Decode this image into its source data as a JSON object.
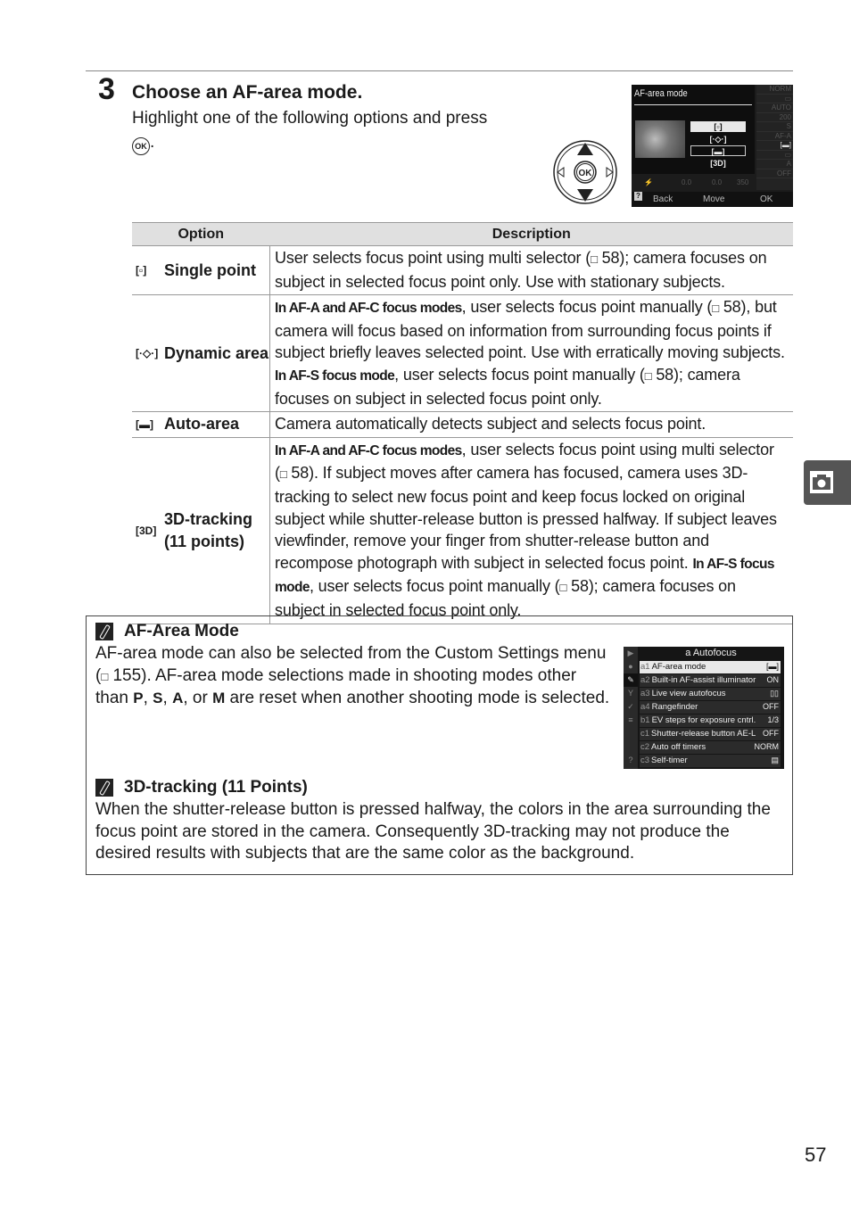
{
  "step": {
    "number": "3",
    "title": "Choose an AF-area mode.",
    "body": "Highlight one of the following options and press",
    "ok_glyph": "OK",
    "body_end": "."
  },
  "camera_screen": {
    "title": "AF-area mode",
    "options": [
      "[▫]",
      "[·◇·]",
      "[▬]",
      "[3D]"
    ],
    "selected_index": 0,
    "side_panel": [
      "NORM",
      "▭",
      "AUTO",
      "200",
      "S",
      "AF-A",
      "[▬]",
      "▭",
      "A",
      "OFF"
    ],
    "bottom_strip": [
      "⚡",
      "0.0",
      "0.0",
      "350"
    ],
    "footer": {
      "help": "?",
      "back": "Back",
      "move": "Move",
      "ok": "OK"
    }
  },
  "table": {
    "headers": [
      "Option",
      "Description"
    ],
    "rows": [
      {
        "icon": "[▫]",
        "label": "Single point",
        "desc": [
          {
            "t": "User selects focus point using multi selector ("
          },
          {
            "t": "□",
            "book": true
          },
          {
            "t": " 58); camera focuses on subject in selected focus point only.  Use with stationary subjects."
          }
        ]
      },
      {
        "icon": "[·◇·]",
        "label": "Dynamic area",
        "desc": [
          {
            "t": "In AF-A and AF-C focus modes",
            "cond": true
          },
          {
            "t": ", user selects focus point manually ("
          },
          {
            "t": "□",
            "book": true
          },
          {
            "t": " 58), but camera will focus based on information from surrounding focus points if subject briefly leaves selected point.  Use with erratically moving subjects.  "
          },
          {
            "t": "In AF-S focus mode",
            "cond": true
          },
          {
            "t": ", user selects focus point manually ("
          },
          {
            "t": "□",
            "book": true
          },
          {
            "t": " 58); camera focuses on subject in selected focus point only."
          }
        ]
      },
      {
        "icon": "[▬]",
        "label": "Auto-area",
        "desc": [
          {
            "t": "Camera automatically detects subject and selects focus point."
          }
        ]
      },
      {
        "icon": "[3D]",
        "label": "3D-tracking (11 points)",
        "desc": [
          {
            "t": "In AF-A and AF-C focus modes",
            "cond": true
          },
          {
            "t": ", user selects focus point using multi selector ("
          },
          {
            "t": "□",
            "book": true
          },
          {
            "t": " 58).  If subject moves after camera has focused, camera uses 3D-tracking to select new focus point and keep focus locked on original subject while shutter-release button is pressed halfway.  If subject leaves viewfinder, remove your finger from shutter-release button and recompose photograph with subject in selected focus point.  "
          },
          {
            "t": "In AF-S focus mode",
            "cond": true
          },
          {
            "t": ", user selects focus point manually ("
          },
          {
            "t": "□",
            "book": true
          },
          {
            "t": " 58); camera focuses on subject in selected focus point only."
          }
        ]
      }
    ]
  },
  "notes": [
    {
      "title": "AF-Area Mode",
      "text_a": "AF-area mode can also be selected from the Custom Settings menu (",
      "book": "□",
      "text_b": " 155).  AF-area mode selections made in shooting modes other than ",
      "modes": [
        "P",
        "S",
        "A",
        "M"
      ],
      "text_c": " are reset when another shooting mode is selected."
    },
    {
      "title": "3D-tracking (11 Points)",
      "text": "When the shutter-release button is pressed halfway, the colors in the area surrounding the focus point are stored in the camera.  Consequently 3D-tracking may not produce the desired results with subjects that are the same color as the background."
    }
  ],
  "menu_screen": {
    "title": "a Autofocus",
    "rail": [
      "▶",
      "●",
      "✎",
      "Y",
      "✓",
      "≡",
      "",
      "",
      "?"
    ],
    "rows": [
      {
        "code": "a1",
        "label": "AF-area mode",
        "value": "[▬]"
      },
      {
        "code": "a2",
        "label": "Built-in AF-assist illuminator",
        "value": "ON"
      },
      {
        "code": "a3",
        "label": "Live view autofocus",
        "value": "▯▯"
      },
      {
        "code": "a4",
        "label": "Rangefinder",
        "value": "OFF"
      },
      {
        "code": "b1",
        "label": "EV steps for exposure cntrl.",
        "value": "1/3"
      },
      {
        "code": "c1",
        "label": "Shutter-release button AE-L",
        "value": "OFF"
      },
      {
        "code": "c2",
        "label": "Auto off timers",
        "value": "NORM"
      },
      {
        "code": "c3",
        "label": "Self-timer",
        "value": "▤"
      }
    ],
    "selected_index": 0
  },
  "side_tab": {
    "icon": "camera-icon"
  },
  "page_number": "57"
}
